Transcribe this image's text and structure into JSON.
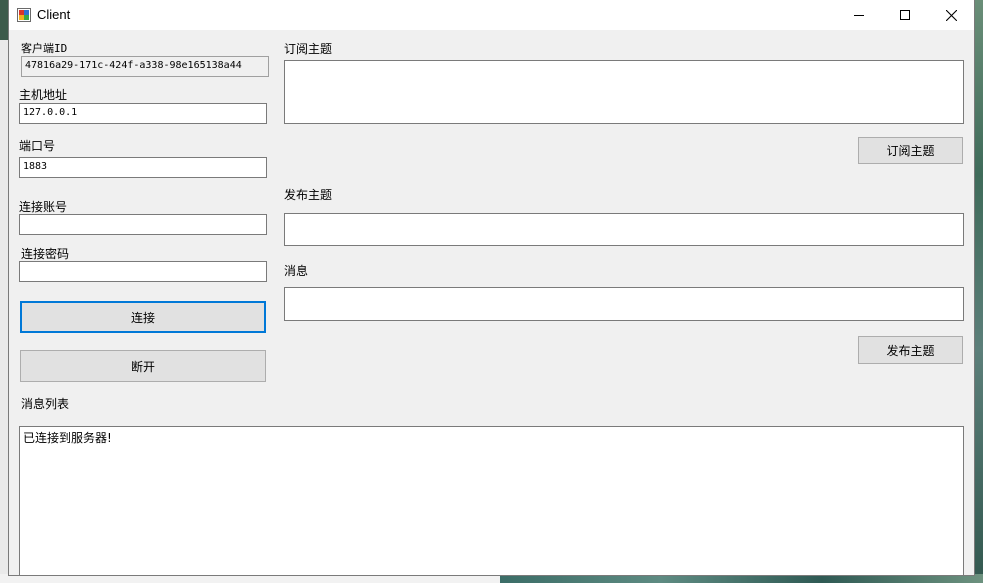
{
  "window": {
    "title": "Client"
  },
  "form": {
    "client_id_label": "客户端ID",
    "client_id_value": "47816a29-171c-424f-a338-98e165138a44",
    "host_label": "主机地址",
    "host_value": "127.0.0.1",
    "port_label": "端口号",
    "port_value": "1883",
    "account_label": "连接账号",
    "account_value": "",
    "password_label": "连接密码",
    "password_value": "",
    "connect_button": "连接",
    "disconnect_button": "断开",
    "message_list_label": "消息列表",
    "message_list_items": [
      "已连接到服务器!"
    ],
    "subscribe_topic_label": "订阅主题",
    "subscribe_topic_value": "",
    "subscribe_button": "订阅主题",
    "publish_topic_label": "发布主题",
    "publish_topic_value": "",
    "message_label": "消息",
    "message_value": "",
    "publish_button": "发布主题"
  },
  "icons": {
    "app": "app-icon",
    "minimize": "minimize-icon",
    "maximize": "maximize-icon",
    "close": "close-icon"
  },
  "colors": {
    "focus_border": "#0078d7",
    "window_bg": "#f0f0f0",
    "titlebar_bg": "#ffffff"
  }
}
